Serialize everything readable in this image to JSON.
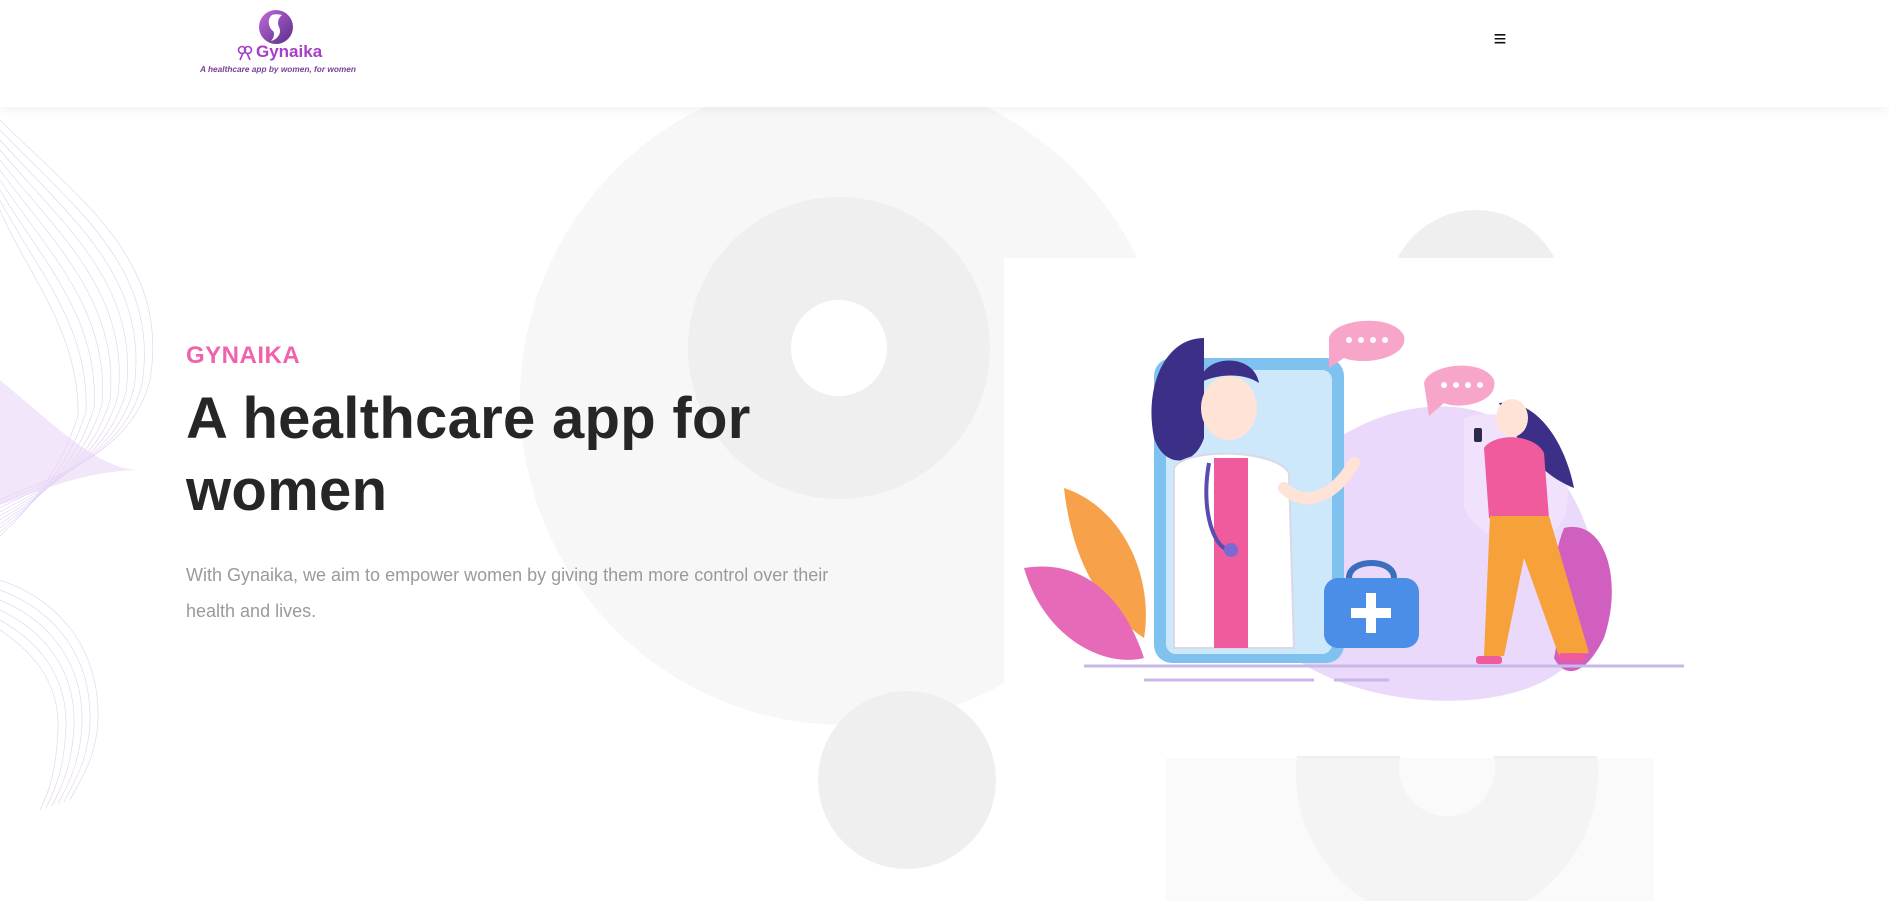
{
  "brand": {
    "name": "Gynaika",
    "tagline": "A healthcare app by women, for women",
    "logo_icon": "woman-silhouette-icon",
    "colors": {
      "purple": "#a63fc6",
      "pink": "#f062ac"
    }
  },
  "header": {
    "menu_icon": "hamburger-menu-icon",
    "menu_glyph": "≡"
  },
  "hero": {
    "eyebrow": "GYNAIKA",
    "title": "A healthcare app for women",
    "description": "With Gynaika, we aim to empower women by giving them more control over their health and lives.",
    "illustration_icon": "doctor-consultation-illustration"
  }
}
